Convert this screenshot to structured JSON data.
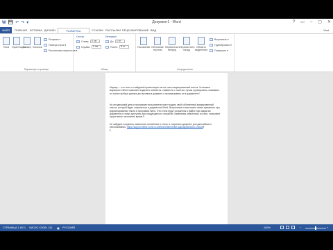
{
  "title": "Документ1 - Word",
  "qat": [
    "W",
    "💾",
    "↶",
    "↷",
    "▾"
  ],
  "window_controls": [
    "?",
    "▭",
    "–",
    "▢",
    "✕"
  ],
  "tabs": [
    "ФАЙЛ",
    "ГЛАВНАЯ",
    "ВСТАВКА",
    "ДИЗАЙН",
    "РАЗМЕТКА СТРАНИЦЫ",
    "ССЫЛКИ",
    "РАССЫЛКИ",
    "РЕЦЕНЗИРОВАНИЕ",
    "ВИД"
  ],
  "active_tab": "РАЗМЕТКА СТРАНИЦЫ",
  "user": "Vlad",
  "ribbon": {
    "page_setup": {
      "label": "Параметры страницы",
      "buttons": [
        "Поля",
        "Ориентация",
        "Размер",
        "Колонки"
      ],
      "rows": [
        "Разрывы ▾",
        "Номера строк ▾",
        "Расстановка переносов ▾"
      ]
    },
    "paragraph": {
      "label": "Абзац",
      "indent_title": "Отступ",
      "interval_title": "Интервал",
      "left": "Слева:",
      "left_value": "0 см",
      "right": "Справа:",
      "right_value": "0 см",
      "before": "До:",
      "before_value": "0 пт",
      "after": "После:",
      "after_value": "8 пт"
    },
    "arrange": {
      "label": "Упорядочение",
      "buttons": [
        "Положение",
        "Обтекание текстом",
        "Переместить вперед",
        "Переместить назад",
        "Область выделения"
      ],
      "rows": [
        "Выровнять ▾",
        "Группировать ▾",
        "Повернуть ▾"
      ]
    }
  },
  "document": {
    "paragraphs": [
      "Маркер — это текст в слайдовой презентации так же, как и маркированный список. Установка маркеров в Word позволяет выделить элементы, совместно с текстом, лучше группировать, связывать по логике выбора данных для вставки в документ и просматривать их в документе.",
      "На сегодняшний день в программе пользователи могут задать свой собственный маркированный список, который будет сохраняться в документах Word. Встроенные стили можно также применять при форматировании текста в программе Word. Эти стили будут сохранены в файле при закрытии документа и станут доступны при следующем его открытии. Изменения, внесённые в стили, позволяют существенно экономить время.",
      "Не забудьте сохранить изменения, внесённые в стили, и сохранить документ для дальнейшего использования."
    ],
    "link_text": "https://support.office.com/ru-ru/article/Изменение-маркированного-списка"
  },
  "status": {
    "page": "СТРАНИЦА 1 ИЗ 1",
    "words": "ЧИСЛО СЛОВ: 131",
    "lang": "РУССКИЙ",
    "zoom": "100%"
  }
}
